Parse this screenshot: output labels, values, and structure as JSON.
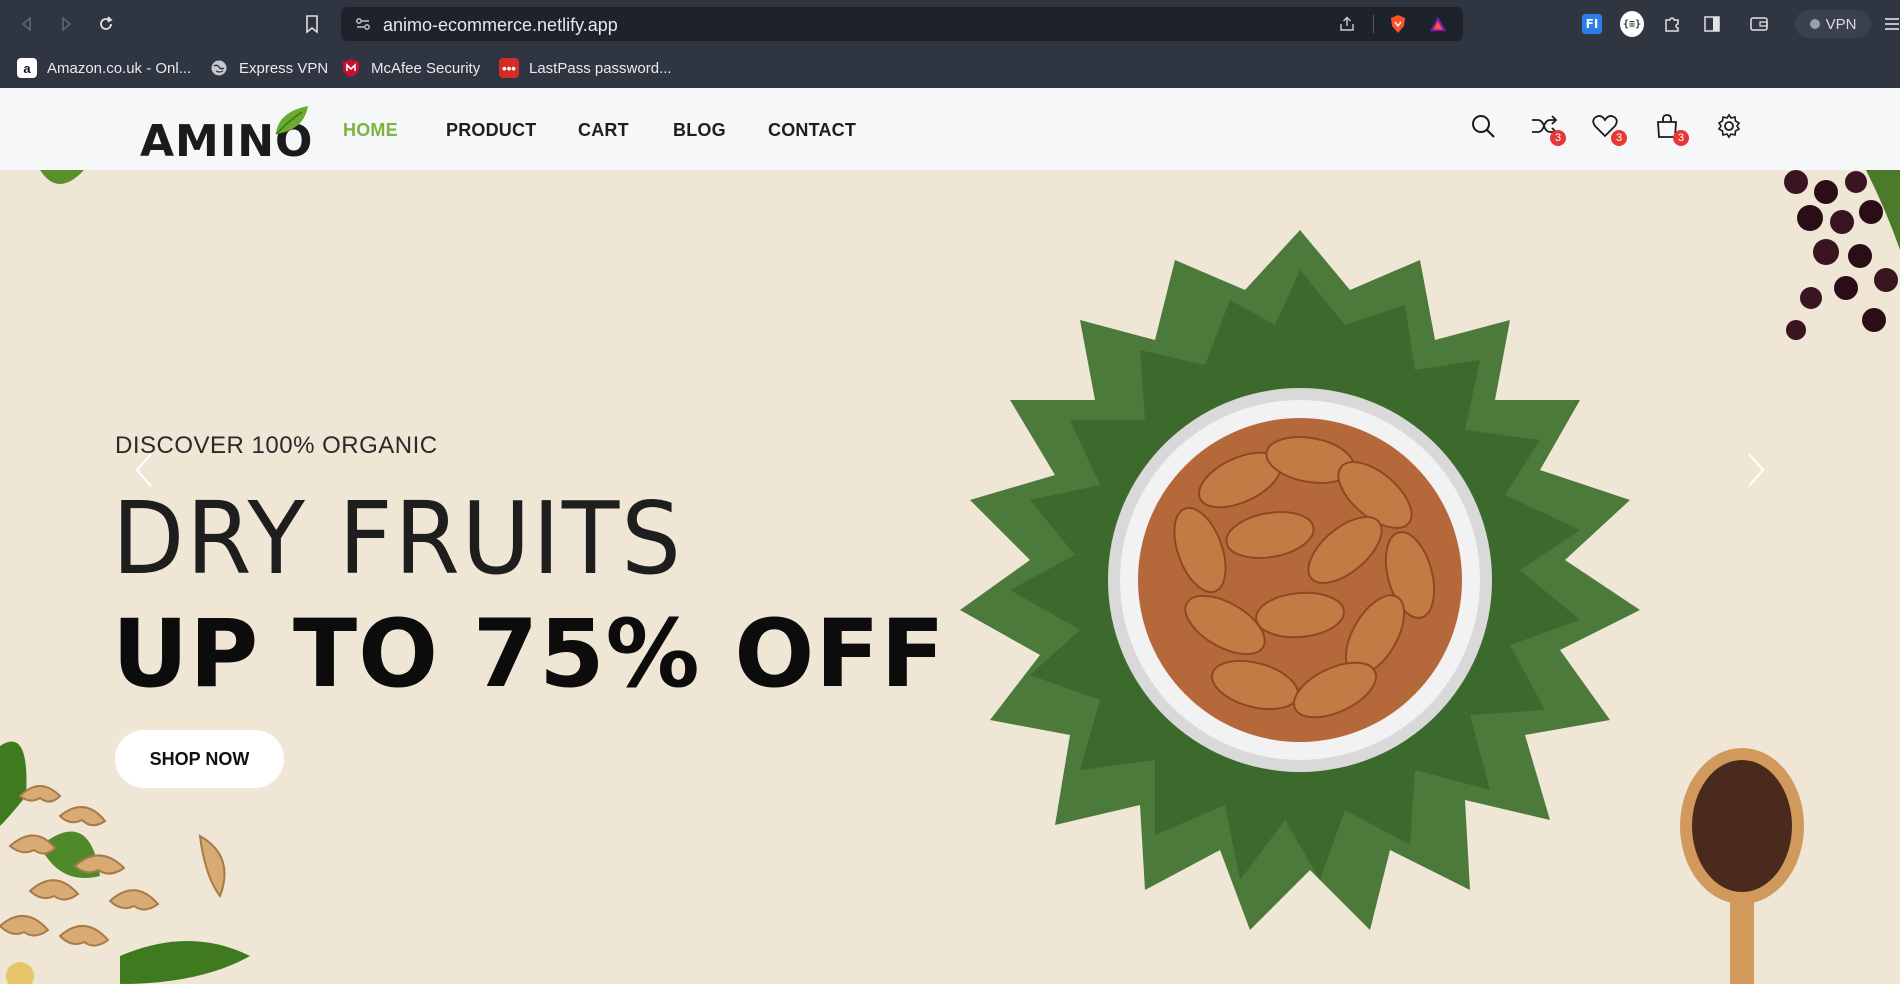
{
  "browser": {
    "url": "animo-ecommerce.netlify.app",
    "vpn_label": "VPN",
    "bookmarks": [
      {
        "label": "Amazon.co.uk - Onl...",
        "icon": "amazon-icon"
      },
      {
        "label": "Express VPN",
        "icon": "globe-icon"
      },
      {
        "label": "McAfee Security",
        "icon": "mcafee-icon"
      },
      {
        "label": "LastPass password...",
        "icon": "lastpass-icon"
      }
    ]
  },
  "site": {
    "logo_text": "AMINO",
    "nav": [
      {
        "label": "HOME",
        "active": true
      },
      {
        "label": "PRODUCT",
        "active": false
      },
      {
        "label": "CART",
        "active": false
      },
      {
        "label": "BLOG",
        "active": false
      },
      {
        "label": "CONTACT",
        "active": false
      }
    ],
    "badges": {
      "compare": "3",
      "wishlist": "3",
      "cart": "3"
    }
  },
  "hero": {
    "eyebrow": "DISCOVER 100% ORGANIC",
    "title_thin": "DRY FRUITS",
    "title_bold": "UP TO 75% OFF",
    "cta": "SHOP NOW"
  },
  "colors": {
    "accent": "#7cb342",
    "badge": "#e53935",
    "hero_bg": "#efe6d6",
    "chrome_bg": "#2f3541"
  }
}
